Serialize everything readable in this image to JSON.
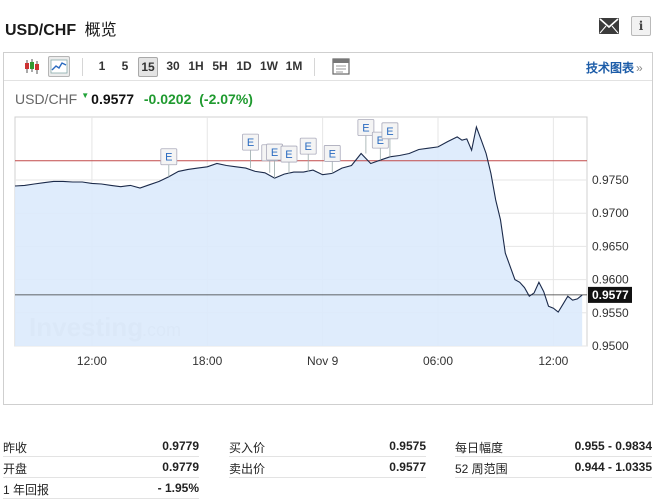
{
  "header": {
    "title": "USD/CHF",
    "title_cn": "概览"
  },
  "toolbar": {
    "timeframes": [
      "1",
      "5",
      "15",
      "30",
      "1H",
      "5H",
      "1D",
      "1W",
      "1M"
    ],
    "active_timeframe": "15",
    "tech_chart_link": "技术图表",
    "tech_chart_chevron": "»"
  },
  "quote": {
    "symbol": "USD/CHF",
    "price": "0.9577",
    "change": "-0.0202",
    "change_pct": "(-2.07%)"
  },
  "chart_data": {
    "type": "area",
    "x_ticks": [
      {
        "label": "12:00",
        "x": 6
      },
      {
        "label": "18:00",
        "x": 30
      },
      {
        "label": "Nov 9",
        "x": 54
      },
      {
        "label": "06:00",
        "x": 78
      },
      {
        "label": "12:00",
        "x": 102
      }
    ],
    "y_ticks": [
      "0.9750",
      "0.9700",
      "0.9650",
      "0.9600",
      "0.9550",
      "0.9500"
    ],
    "ylim": [
      0.95,
      0.9845
    ],
    "xlim": [
      -10,
      109
    ],
    "reference_level": 0.9779,
    "last_price_label": "0.9577",
    "last_price": 0.9577,
    "watermark": "Investing",
    "watermark_suffix": ".com",
    "marker_label": "E",
    "event_markers": [
      22,
      39,
      43,
      44,
      47,
      51,
      56,
      63,
      66,
      68
    ],
    "colors": {
      "line": "#1b2a4a",
      "fill": "#dbeafc",
      "ref_line": "#c24a4a",
      "grid": "#e6e6e6"
    },
    "series": [
      {
        "x": [
          -10,
          -8,
          -6,
          -4,
          -2,
          0,
          2,
          4,
          6,
          8,
          10,
          12,
          14,
          16,
          18,
          20,
          22,
          24,
          26,
          28,
          30,
          32,
          34,
          36,
          38,
          40,
          42,
          44,
          46,
          48,
          50,
          52,
          54,
          56,
          58,
          60,
          62,
          64,
          66,
          68,
          70,
          72,
          74,
          76,
          78,
          80,
          82,
          83,
          84,
          85,
          86,
          87,
          88,
          89,
          90,
          91,
          92,
          93,
          94,
          95,
          96,
          97,
          98,
          99,
          100,
          101,
          102,
          103,
          104,
          105,
          106,
          107,
          108
        ],
        "values": [
          0.9741,
          0.9742,
          0.9744,
          0.9746,
          0.9748,
          0.9748,
          0.9747,
          0.9747,
          0.9745,
          0.9744,
          0.9742,
          0.974,
          0.9742,
          0.9738,
          0.9743,
          0.9748,
          0.9755,
          0.9763,
          0.9766,
          0.9768,
          0.977,
          0.9775,
          0.9772,
          0.977,
          0.9768,
          0.9763,
          0.9761,
          0.9753,
          0.9759,
          0.9762,
          0.9762,
          0.9765,
          0.9758,
          0.976,
          0.9768,
          0.9772,
          0.979,
          0.9775,
          0.978,
          0.9785,
          0.9787,
          0.979,
          0.9796,
          0.9798,
          0.98,
          0.9808,
          0.9815,
          0.981,
          0.9812,
          0.9795,
          0.983,
          0.981,
          0.979,
          0.976,
          0.972,
          0.969,
          0.964,
          0.962,
          0.96,
          0.9596,
          0.9588,
          0.9575,
          0.958,
          0.9596,
          0.9582,
          0.956,
          0.9557,
          0.9551,
          0.9563,
          0.9575,
          0.9569,
          0.9571,
          0.9577
        ]
      }
    ]
  },
  "stats": {
    "col1": [
      {
        "label": "昨收",
        "value": "0.9779"
      },
      {
        "label": "开盘",
        "value": "0.9779"
      },
      {
        "label": "1 年回报",
        "value": "- 1.95%"
      }
    ],
    "col2": [
      {
        "label": "买入价",
        "value": "0.9575"
      },
      {
        "label": "卖出价",
        "value": "0.9577"
      }
    ],
    "col3": [
      {
        "label": "每日幅度",
        "value": "0.955 - 0.9834"
      },
      {
        "label": "52 周范围",
        "value": "0.944 - 1.0335"
      }
    ]
  }
}
